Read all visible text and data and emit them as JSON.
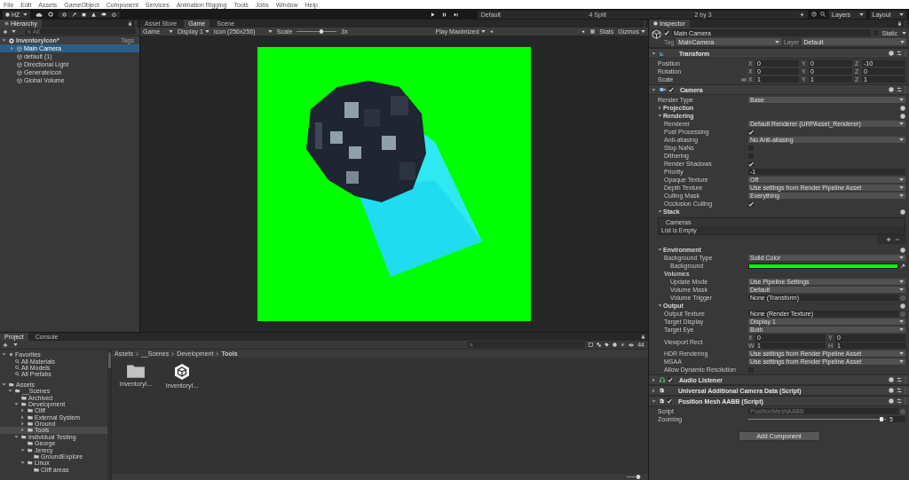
{
  "menu": [
    "File",
    "Edit",
    "Assets",
    "GameObject",
    "Component",
    "Services",
    "Animation Rigging",
    "Tools",
    "Jobs",
    "Window",
    "Help"
  ],
  "toolbar": {
    "account": "HZ",
    "layouts": [
      "Default",
      "4 Split",
      "2 by 3"
    ],
    "layers": "Layers",
    "layout": "Layout"
  },
  "hierarchy": {
    "title": "Hierarchy",
    "search_placeholder": "All",
    "scene": {
      "name": "InventoryIcon*",
      "tag": "Tags",
      "expanded": true
    },
    "items": [
      {
        "name": "Main Camera",
        "selected": true,
        "expanded": false
      },
      {
        "name": "default (1)",
        "selected": false
      },
      {
        "name": "Directional Light",
        "selected": false
      },
      {
        "name": "GenerateIcon",
        "selected": false
      },
      {
        "name": "Global Volume",
        "selected": false
      }
    ]
  },
  "game": {
    "tabs": [
      {
        "label": "Asset Store",
        "selected": false
      },
      {
        "label": "Game",
        "selected": true
      },
      {
        "label": "Scene",
        "selected": false
      }
    ],
    "toolbar": {
      "mode": "Game",
      "display": "Display 1",
      "resolution": "Icon (256x256)",
      "scale_label": "Scale",
      "scale": {
        "level": 0.62
      },
      "scale_value": "3x",
      "play_mode": "Play Maximized",
      "stats": "Stats",
      "gizmos": "Gizmos"
    }
  },
  "inspector": {
    "title": "Inspector",
    "object": {
      "name": "Main Camera",
      "active": true,
      "static": false,
      "static_label": "Static",
      "tag_label": "Tag",
      "tag": "MainCamera",
      "layer_label": "Layer",
      "layer": "Default"
    },
    "components": [
      {
        "name": "Transform",
        "kind": "transform",
        "expanded": true,
        "rows": [
          {
            "kind": "vector",
            "label": "Position",
            "fields": [
              {
                "axis": "X",
                "value": "0"
              },
              {
                "axis": "Y",
                "value": "0"
              },
              {
                "axis": "Z",
                "value": "-10"
              }
            ]
          },
          {
            "kind": "vector",
            "label": "Rotation",
            "fields": [
              {
                "axis": "X",
                "value": "0"
              },
              {
                "axis": "Y",
                "value": "0"
              },
              {
                "axis": "Z",
                "value": "0"
              }
            ]
          },
          {
            "kind": "vector",
            "label": "Scale",
            "proportions_toggle": true,
            "fields": [
              {
                "axis": "X",
                "value": "1"
              },
              {
                "axis": "Y",
                "value": "1"
              },
              {
                "axis": "Z",
                "value": "1"
              }
            ]
          }
        ]
      },
      {
        "name": "Camera",
        "kind": "camera",
        "enabled": true,
        "expanded": true,
        "rows": [
          {
            "kind": "dropdown",
            "label": "Render Type",
            "value": "Base"
          },
          {
            "kind": "foldout",
            "label": "Projection",
            "expanded": false,
            "help": true
          },
          {
            "kind": "foldout",
            "label": "Rendering",
            "expanded": true,
            "help": true,
            "children": [
              {
                "kind": "dropdown",
                "label": "Renderer",
                "value": "Default Renderer (URPAsset_Renderer)"
              },
              {
                "kind": "toggle",
                "label": "Post Processing",
                "checked": true
              },
              {
                "kind": "dropdown",
                "label": "Anti-aliasing",
                "value": "No Anti-aliasing"
              },
              {
                "kind": "toggle",
                "label": "Stop NaNs",
                "checked": false
              },
              {
                "kind": "toggle",
                "label": "Dithering",
                "checked": false
              },
              {
                "kind": "toggle",
                "label": "Render Shadows",
                "checked": true
              },
              {
                "kind": "number",
                "label": "Priority",
                "value": "-1"
              },
              {
                "kind": "dropdown",
                "label": "Opaque Texture",
                "value": "Off"
              },
              {
                "kind": "dropdown",
                "label": "Depth Texture",
                "value": "Use settings from Render Pipeline Asset"
              },
              {
                "kind": "dropdown",
                "label": "Culling Mask",
                "value": "Everything"
              },
              {
                "kind": "toggle",
                "label": "Occlusion Culling",
                "checked": true
              }
            ]
          },
          {
            "kind": "foldout",
            "label": "Stack",
            "expanded": true,
            "help": true,
            "children": [
              {
                "kind": "list",
                "header": "Cameras",
                "empty_text": "List is Empty"
              }
            ]
          },
          {
            "kind": "foldout",
            "label": "Environment",
            "expanded": true,
            "help": true,
            "children": [
              {
                "kind": "dropdown",
                "label": "Background Type",
                "value": "Solid Color",
                "children": [
                  {
                    "kind": "color",
                    "label": "Background",
                    "color": "#00ff00"
                  }
                ]
              },
              {
                "kind": "group",
                "label": "Volumes",
                "children": [
                  {
                    "kind": "dropdown",
                    "label": "Update Mode",
                    "value": "Use Pipeline Settings"
                  },
                  {
                    "kind": "dropdown",
                    "label": "Volume Mask",
                    "value": "Default"
                  },
                  {
                    "kind": "object",
                    "label": "Volume Trigger",
                    "value": "None (Transform)"
                  }
                ]
              }
            ]
          },
          {
            "kind": "foldout",
            "label": "Output",
            "expanded": true,
            "help": true,
            "children": [
              {
                "kind": "object",
                "label": "Output Texture",
                "value": "None (Render Texture)"
              },
              {
                "kind": "dropdown",
                "label": "Target Display",
                "value": "Display 1"
              },
              {
                "kind": "dropdown",
                "label": "Target Eye",
                "value": "Both"
              },
              {
                "kind": "vector",
                "label": "Viewport Rect",
                "fields": [
                  {
                    "axis": "X",
                    "value": "0"
                  },
                  {
                    "axis": "Y",
                    "value": "0"
                  },
                  {
                    "axis": "W",
                    "value": "1"
                  },
                  {
                    "axis": "H",
                    "value": "1"
                  }
                ]
              },
              {
                "kind": "dropdown",
                "label": "HDR Rendering",
                "value": "Use settings from Render Pipeline Asset"
              },
              {
                "kind": "dropdown",
                "label": "MSAA",
                "value": "Use settings from Render Pipeline Asset"
              },
              {
                "kind": "toggle",
                "label": "Allow Dynamic Resolution",
                "checked": false
              }
            ]
          }
        ]
      },
      {
        "name": "Audio Listener",
        "kind": "audio",
        "enabled": true,
        "expanded": false
      },
      {
        "name": "Universal Additional Camera Data (Script)",
        "kind": "script",
        "expanded": false
      },
      {
        "name": "Position Mesh AABB (Script)",
        "kind": "script",
        "enabled": true,
        "expanded": true,
        "rows": [
          {
            "kind": "object",
            "label": "Script",
            "value": "PositionMeshAABB",
            "disabled": true
          },
          {
            "kind": "slider",
            "label": "Zooming",
            "level": 0.97,
            "value": "5"
          }
        ]
      }
    ],
    "add_button": "Add Component"
  },
  "project": {
    "tabs": [
      {
        "label": "Project",
        "selected": true
      },
      {
        "label": "Console",
        "selected": false
      }
    ],
    "count": "44",
    "tree": [
      {
        "label": "Favorites",
        "kind": "favorites",
        "expanded": true,
        "selected": false,
        "children": [
          {
            "label": "All Materials",
            "kind": "search",
            "selected": false
          },
          {
            "label": "All Models",
            "kind": "search",
            "selected": false
          },
          {
            "label": "All Prefabs",
            "kind": "search",
            "selected": false
          }
        ]
      },
      {
        "label": "Assets",
        "kind": "folder",
        "expanded": true,
        "selected": false,
        "children": [
          {
            "label": "__Scenes",
            "kind": "folder",
            "expanded": true,
            "selected": false,
            "children": [
              {
                "label": "Archived",
                "kind": "folder",
                "selected": false
              },
              {
                "label": "Development",
                "kind": "folder",
                "expanded": true,
                "selected": false,
                "children": [
                  {
                    "label": "Cliff",
                    "kind": "folder",
                    "expanded": false,
                    "selected": false
                  },
                  {
                    "label": "External System",
                    "kind": "folder",
                    "expanded": false,
                    "selected": false
                  },
                  {
                    "label": "Ground",
                    "kind": "folder",
                    "expanded": false,
                    "selected": false
                  },
                  {
                    "label": "Tools",
                    "kind": "folder",
                    "expanded": false,
                    "selected": true
                  }
                ]
              },
              {
                "label": "Individual Testing",
                "kind": "folder",
                "expanded": true,
                "selected": false,
                "children": [
                  {
                    "label": "George",
                    "kind": "folder",
                    "selected": false
                  },
                  {
                    "label": "Jerecy",
                    "kind": "folder",
                    "expanded": true,
                    "selected": false,
                    "children": [
                      {
                        "label": "GroundExplore",
                        "kind": "folder",
                        "selected": false
                      }
                    ]
                  },
                  {
                    "label": "Linux",
                    "kind": "folder",
                    "expanded": true,
                    "selected": false,
                    "children": [
                      {
                        "label": "Cliff areas",
                        "kind": "folder",
                        "selected": false
                      }
                    ]
                  }
                ]
              }
            ]
          }
        ]
      }
    ],
    "breadcrumb": [
      "Assets",
      "__Scenes",
      "Development",
      "Tools"
    ],
    "files": [
      {
        "name": "InventoryI...",
        "kind": "folder"
      },
      {
        "name": "InventoryI...",
        "kind": "unity"
      }
    ],
    "zoom": {
      "level": 0.8
    }
  }
}
